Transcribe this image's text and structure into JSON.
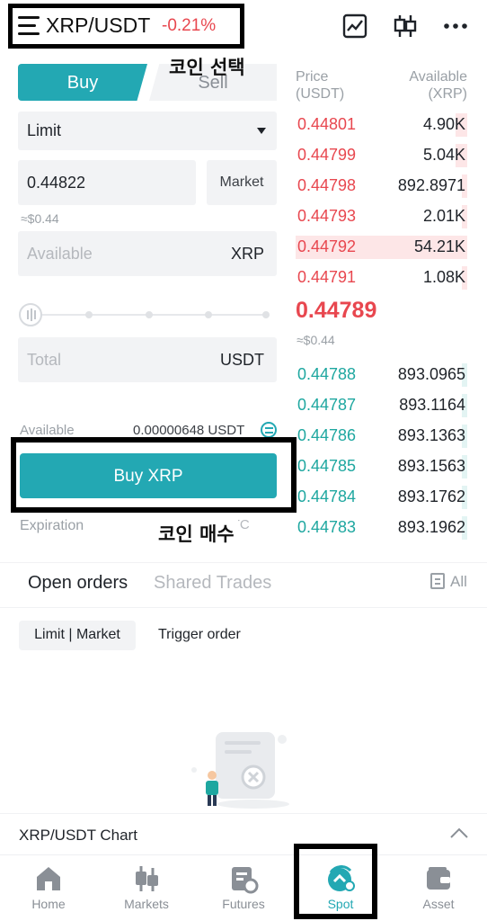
{
  "header": {
    "pair": "XRP/USDT",
    "change": "-0.21%",
    "icons": [
      "menu-icon",
      "chart-line-icon",
      "candlestick-icon",
      "more-dots-icon"
    ]
  },
  "overlay": {
    "select_coin": "코인 선택",
    "buy_coin": "코인 매수"
  },
  "order_form": {
    "tabs": [
      "Buy",
      "Sell"
    ],
    "order_type": "Limit",
    "price": "0.44822",
    "market_label": "Market",
    "price_fiat": "≈$0.44",
    "amount_placeholder": "Available",
    "amount_unit": "XRP",
    "total_placeholder": "Total",
    "total_unit": "USDT",
    "available_label": "Available",
    "available_value": "0.00000648 USDT",
    "buy_button": "Buy XRP",
    "expiration_label": "Expiration",
    "expiration_value": "GTC"
  },
  "order_book": {
    "price_header": [
      "Price",
      "(USDT)"
    ],
    "qty_header": [
      "Available",
      "(XRP)"
    ],
    "asks": [
      {
        "price": "0.44801",
        "qty": "4.90K",
        "depth": 0.07
      },
      {
        "price": "0.44799",
        "qty": "5.04K",
        "depth": 0.07
      },
      {
        "price": "0.44798",
        "qty": "892.8971",
        "depth": 0.02
      },
      {
        "price": "0.44793",
        "qty": "2.01K",
        "depth": 0.03
      },
      {
        "price": "0.44792",
        "qty": "54.21K",
        "depth": 1.0
      },
      {
        "price": "0.44791",
        "qty": "1.08K",
        "depth": 0.02
      }
    ],
    "last_price": "0.44789",
    "last_price_fiat": "≈$0.44",
    "bids": [
      {
        "price": "0.44788",
        "qty": "893.0965",
        "depth": 0.02
      },
      {
        "price": "0.44787",
        "qty": "893.1164",
        "depth": 0.02
      },
      {
        "price": "0.44786",
        "qty": "893.1363",
        "depth": 0.02
      },
      {
        "price": "0.44785",
        "qty": "893.1563",
        "depth": 0.02
      },
      {
        "price": "0.44784",
        "qty": "893.1762",
        "depth": 0.02
      },
      {
        "price": "0.44783",
        "qty": "893.1962",
        "depth": 0.02
      }
    ]
  },
  "orders": {
    "tabs": [
      "Open orders",
      "Shared Trades"
    ],
    "all_label": "All",
    "filters": [
      "Limit | Market",
      "Trigger order"
    ]
  },
  "chart_bar": {
    "label": "XRP/USDT Chart"
  },
  "nav": {
    "items": [
      {
        "label": "Home",
        "icon": "home-icon"
      },
      {
        "label": "Markets",
        "icon": "markets-icon"
      },
      {
        "label": "Futures",
        "icon": "futures-icon"
      },
      {
        "label": "Spot",
        "icon": "spot-icon"
      },
      {
        "label": "Asset",
        "icon": "wallet-icon"
      }
    ],
    "active": "Spot"
  },
  "colors": {
    "accent": "#23a8b3",
    "sell_red": "#e8474f",
    "buy_green": "#1ea7a0",
    "field_bg": "#f2f3f5"
  }
}
